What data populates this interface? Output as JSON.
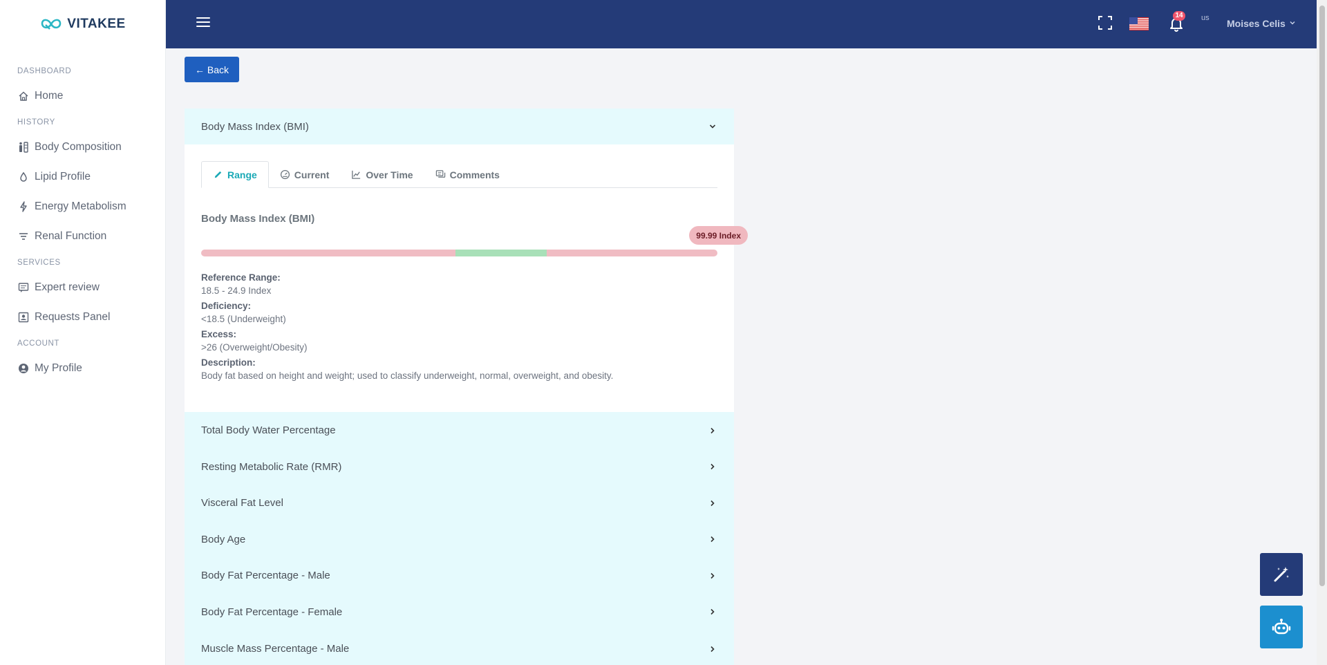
{
  "brand": {
    "name": "VITAKEE",
    "accent": "#2bb7c4"
  },
  "sidebar": {
    "sections": [
      {
        "title": "DASHBOARD",
        "items": [
          {
            "label": "Home",
            "icon": "home-icon"
          }
        ]
      },
      {
        "title": "HISTORY",
        "items": [
          {
            "label": "Body Composition",
            "icon": "body-icon"
          },
          {
            "label": "Lipid Profile",
            "icon": "drop-icon"
          },
          {
            "label": "Energy Metabolism",
            "icon": "bolt-icon"
          },
          {
            "label": "Renal Function",
            "icon": "filter-icon"
          }
        ]
      },
      {
        "title": "SERVICES",
        "items": [
          {
            "label": "Expert review",
            "icon": "message-icon"
          },
          {
            "label": "Requests Panel",
            "icon": "inbox-icon"
          }
        ]
      },
      {
        "title": "ACCOUNT",
        "items": [
          {
            "label": "My Profile",
            "icon": "user-icon"
          }
        ]
      }
    ]
  },
  "topbar": {
    "notification_count": "14",
    "avatar_alt": "us",
    "user_name": "Moises Celis",
    "color": "#243b78"
  },
  "back_label": "← Back",
  "bmi": {
    "header": "Body Mass Index (BMI)",
    "tabs": [
      {
        "label": "Range",
        "icon": "pencil-icon",
        "active": true
      },
      {
        "label": "Current",
        "icon": "gauge-icon"
      },
      {
        "label": "Over Time",
        "icon": "line-chart-icon"
      },
      {
        "label": "Comments",
        "icon": "comments-icon"
      }
    ],
    "title": "Body Mass Index (BMI)",
    "value_label": "99.99 Index",
    "value_fraction": 1.0,
    "range_segments": [
      {
        "status": "deficiency",
        "fraction": 0.493,
        "color": "#f0bcc3"
      },
      {
        "status": "normal",
        "fraction": 0.176,
        "color": "#a8e0b8"
      },
      {
        "status": "excess",
        "fraction": 0.331,
        "color": "#f0bcc3"
      }
    ],
    "reference_label": "Reference Range:",
    "reference_value": "18.5 - 24.9 Index",
    "deficiency_label": "Deficiency:",
    "deficiency_value": "<18.5 (Underweight)",
    "excess_label": "Excess:",
    "excess_value": ">26 (Overweight/Obesity)",
    "description_label": "Description:",
    "description_value": "Body fat based on height and weight; used to classify underweight, normal, overweight, and obesity."
  },
  "other_metrics": [
    "Total Body Water Percentage",
    "Resting Metabolic Rate (RMR)",
    "Visceral Fat Level",
    "Body Age",
    "Body Fat Percentage - Male",
    "Body Fat Percentage - Female",
    "Muscle Mass Percentage - Male"
  ]
}
